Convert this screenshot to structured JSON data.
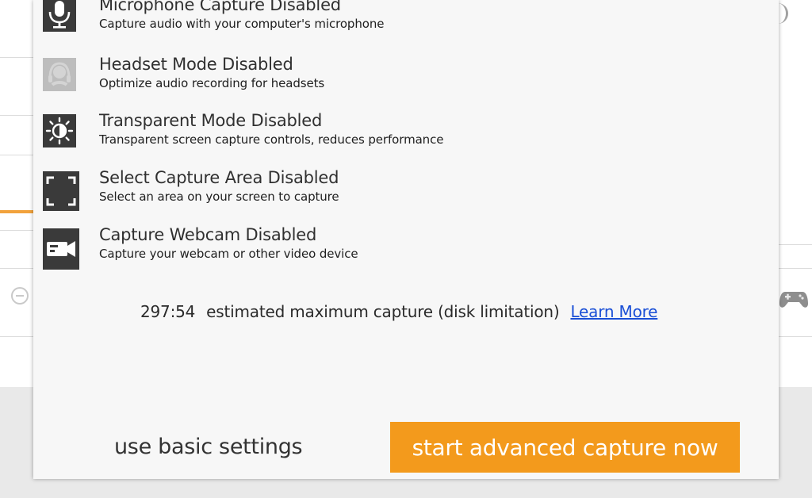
{
  "options": [
    {
      "title": "Microphone Capture Disabled",
      "description": "Capture audio with your computer's microphone",
      "icon": "microphone-icon"
    },
    {
      "title": "Headset Mode Disabled",
      "description": "Optimize audio recording for headsets",
      "icon": "headset-icon"
    },
    {
      "title": "Transparent Mode Disabled",
      "description": "Transparent screen capture controls, reduces performance",
      "icon": "transparency-icon"
    },
    {
      "title": "Select Capture Area Disabled",
      "description": "Select an area on your screen to capture",
      "icon": "capture-area-icon"
    },
    {
      "title": "Capture Webcam Disabled",
      "description": "Capture your webcam or other video device",
      "icon": "webcam-icon"
    }
  ],
  "estimate": {
    "time": "297:54",
    "text": "estimated maximum capture (disk limitation)",
    "link": "Learn More"
  },
  "buttons": {
    "basic": "use basic settings",
    "start": "start advanced capture now"
  },
  "colors": {
    "accent": "#f39a1c",
    "link": "#1a4fd6",
    "icon_bg": "#3a3a3a",
    "icon_disabled_bg": "#bdbdbd"
  }
}
